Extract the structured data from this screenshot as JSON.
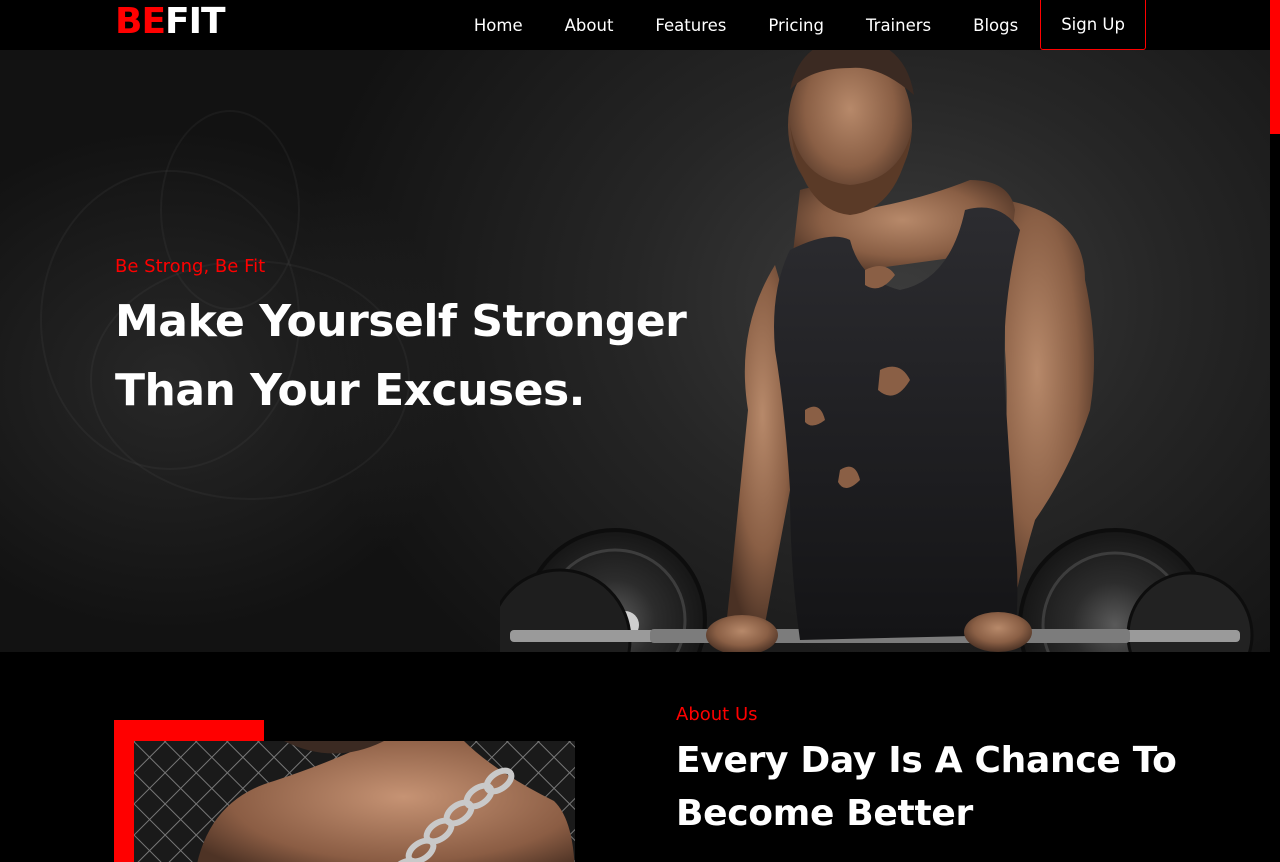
{
  "brand": {
    "part1": "BE",
    "part2": "FIT"
  },
  "nav": [
    {
      "label": "Home"
    },
    {
      "label": "About"
    },
    {
      "label": "Features"
    },
    {
      "label": "Pricing"
    },
    {
      "label": "Trainers"
    },
    {
      "label": "Blogs"
    }
  ],
  "signup_label": "Sign Up",
  "hero": {
    "tagline": "Be Strong, Be Fit",
    "headline_line1": "Make Yourself Stronger",
    "headline_line2": "Than Your Excuses."
  },
  "about": {
    "label": "About Us",
    "heading_line1": "Every Day Is A Chance To",
    "heading_line2": "Become Better"
  },
  "colors": {
    "accent": "#ff0000",
    "background": "#000000",
    "text": "#ffffff"
  }
}
